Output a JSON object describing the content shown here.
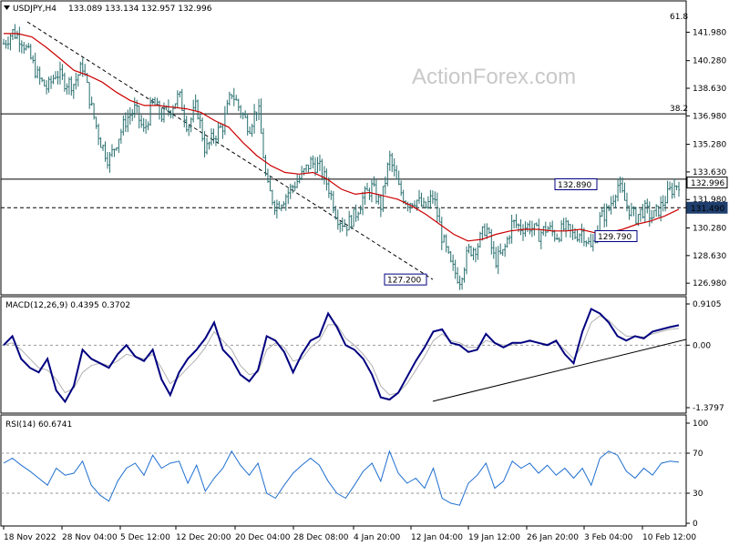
{
  "header": {
    "symbol_label": "USDJPY,H4",
    "ohlc": "133.089 133.134 132.957 132.996",
    "watermark": "ActionForex.com"
  },
  "colors": {
    "candle": "#2a6f6f",
    "ma": "#cc0000",
    "macd": "#000080",
    "signal": "#b0b0b0",
    "rsi": "#1f6fd0",
    "box_border": "#000080"
  },
  "chart_data": [
    {
      "type": "ohlc",
      "title": "USDJPY,H4",
      "ylim": [
        126.5,
        142.6
      ],
      "y_ticks": [
        "141.980",
        "140.280",
        "138.630",
        "136.980",
        "135.280",
        "133.630",
        "131.980",
        "130.280",
        "128.630",
        "126.980"
      ],
      "x_ticks": [
        "18 Nov 2022",
        "28 Nov 04:00",
        "5 Dec 12:00",
        "12 Dec 20:00",
        "20 Dec 04:00",
        "28 Dec 08:00",
        "4 Jan 20:00",
        "12 Jan 04:00",
        "19 Jan 12:00",
        "26 Jan 20:00",
        "3 Feb 04:00",
        "10 Feb 12:00"
      ],
      "current_price": "132.996",
      "level_line": "131.490",
      "fib_labels": [
        {
          "text": "61.8",
          "price": 142.6
        },
        {
          "text": "38.2",
          "price": 137.1
        }
      ],
      "horizontal_levels": [
        137.1,
        133.2
      ],
      "dashed_level": 131.49,
      "price_boxes": [
        {
          "text": "132.890",
          "price": 132.89
        },
        {
          "text": "129.790",
          "price": 129.79
        },
        {
          "text": "127.200",
          "price": 127.2
        }
      ],
      "trendline": {
        "from_label": "18 Nov 2022",
        "from": 142.6,
        "to_label": "12 Jan 04:00",
        "to": 127.2
      },
      "price_path": [
        141.3,
        142.0,
        141.6,
        140.5,
        139.2,
        138.6,
        139.6,
        139.0,
        138.9,
        140.0,
        137.5,
        135.5,
        134.3,
        135.6,
        136.8,
        137.4,
        136.0,
        137.8,
        137.0,
        137.4,
        138.2,
        136.3,
        137.6,
        134.9,
        135.8,
        136.4,
        138.4,
        137.3,
        136.3,
        137.6,
        132.8,
        131.6,
        132.1,
        132.8,
        133.4,
        134.2,
        133.9,
        132.8,
        131.0,
        130.4,
        131.0,
        132.1,
        132.7,
        131.6,
        134.5,
        132.7,
        131.8,
        132.0,
        131.4,
        132.2,
        129.7,
        128.0,
        127.2,
        128.9,
        129.2,
        130.4,
        128.3,
        128.8,
        130.6,
        130.3,
        130.4,
        129.9,
        130.3,
        129.8,
        130.3,
        129.8,
        130.1,
        129.0,
        130.8,
        131.4,
        132.9,
        131.7,
        130.9,
        131.4,
        130.9,
        131.6,
        132.5,
        133.0
      ],
      "ma_path": [
        141.9,
        141.9,
        141.7,
        141.1,
        140.4,
        139.7,
        139.4,
        139.0,
        138.4,
        137.9,
        137.6,
        137.6,
        137.5,
        137.4,
        137.2,
        136.7,
        136.3,
        135.4,
        134.6,
        134.0,
        133.6,
        133.5,
        133.6,
        133.2,
        132.6,
        132.3,
        132.4,
        132.2,
        132.0,
        131.6,
        131.1,
        130.5,
        129.9,
        129.5,
        129.6,
        129.9,
        130.1,
        130.2,
        130.2,
        130.1,
        130.1,
        130.2,
        130.0,
        130.0,
        130.2,
        130.5,
        130.7,
        131.0,
        131.4
      ]
    },
    {
      "type": "line",
      "title": "MACD(12,26,9) 0.4395 0.3702",
      "ylim": [
        -1.3797,
        0.9105
      ],
      "y_ticks": [
        "0.9105",
        "0.00",
        "-1.3797"
      ],
      "current_label": "0.00",
      "series": [
        {
          "name": "MACD",
          "values": [
            0.0,
            0.2,
            -0.3,
            -0.5,
            -0.6,
            -0.3,
            -1.0,
            -1.25,
            -0.9,
            -0.1,
            -0.3,
            -0.4,
            -0.5,
            -0.2,
            0.0,
            -0.25,
            -0.35,
            -0.1,
            -0.75,
            -1.1,
            -0.6,
            -0.3,
            -0.1,
            0.15,
            0.5,
            -0.1,
            -0.3,
            -0.65,
            -0.8,
            -0.55,
            0.2,
            0.1,
            -0.15,
            -0.6,
            -0.2,
            0.1,
            0.2,
            0.7,
            0.4,
            0.0,
            -0.1,
            -0.3,
            -0.65,
            -1.15,
            -1.2,
            -1.05,
            -0.7,
            -0.35,
            -0.05,
            0.3,
            0.35,
            0.05,
            0.0,
            -0.15,
            -0.1,
            0.25,
            0.05,
            -0.05,
            0.05,
            0.05,
            0.1,
            0.05,
            0.0,
            0.1,
            -0.2,
            -0.4,
            0.3,
            0.8,
            0.7,
            0.5,
            0.2,
            0.1,
            0.2,
            0.15,
            0.3,
            0.35,
            0.4,
            0.44
          ]
        },
        {
          "name": "Signal",
          "values": [
            0.0,
            0.05,
            -0.1,
            -0.3,
            -0.5,
            -0.55,
            -0.75,
            -1.05,
            -0.95,
            -0.6,
            -0.45,
            -0.4,
            -0.45,
            -0.35,
            -0.2,
            -0.25,
            -0.3,
            -0.2,
            -0.5,
            -0.85,
            -0.7,
            -0.5,
            -0.3,
            -0.05,
            0.3,
            0.1,
            -0.1,
            -0.45,
            -0.65,
            -0.6,
            -0.1,
            0.05,
            -0.05,
            -0.35,
            -0.3,
            -0.05,
            0.1,
            0.45,
            0.45,
            0.15,
            0.0,
            -0.2,
            -0.45,
            -0.9,
            -1.1,
            -1.05,
            -0.85,
            -0.55,
            -0.25,
            0.1,
            0.25,
            0.1,
            0.05,
            -0.05,
            -0.05,
            0.1,
            0.05,
            0.0,
            0.0,
            0.05,
            0.08,
            0.06,
            0.02,
            0.06,
            -0.1,
            -0.3,
            0.0,
            0.5,
            0.65,
            0.55,
            0.35,
            0.2,
            0.2,
            0.18,
            0.25,
            0.3,
            0.35,
            0.37
          ]
        }
      ],
      "trendline": {
        "from_label": "12 Jan 04:00",
        "to_label": "10 Feb 12:00"
      }
    },
    {
      "type": "line",
      "title": "RSI(14) 60.6741",
      "ylim": [
        0,
        100
      ],
      "y_ticks": [
        "100",
        "70",
        "30",
        "0"
      ],
      "levels": [
        70,
        30
      ],
      "series": [
        {
          "name": "RSI",
          "values": [
            60,
            65,
            58,
            52,
            45,
            38,
            55,
            48,
            50,
            62,
            38,
            28,
            22,
            42,
            55,
            60,
            48,
            68,
            55,
            60,
            62,
            40,
            58,
            32,
            45,
            55,
            72,
            58,
            48,
            60,
            30,
            25,
            38,
            50,
            58,
            65,
            58,
            42,
            30,
            25,
            38,
            52,
            60,
            42,
            72,
            50,
            40,
            45,
            35,
            55,
            25,
            20,
            18,
            40,
            48,
            60,
            35,
            42,
            62,
            55,
            60,
            50,
            58,
            48,
            55,
            45,
            55,
            38,
            65,
            72,
            68,
            52,
            45,
            55,
            48,
            60,
            62,
            61
          ]
        }
      ]
    }
  ]
}
